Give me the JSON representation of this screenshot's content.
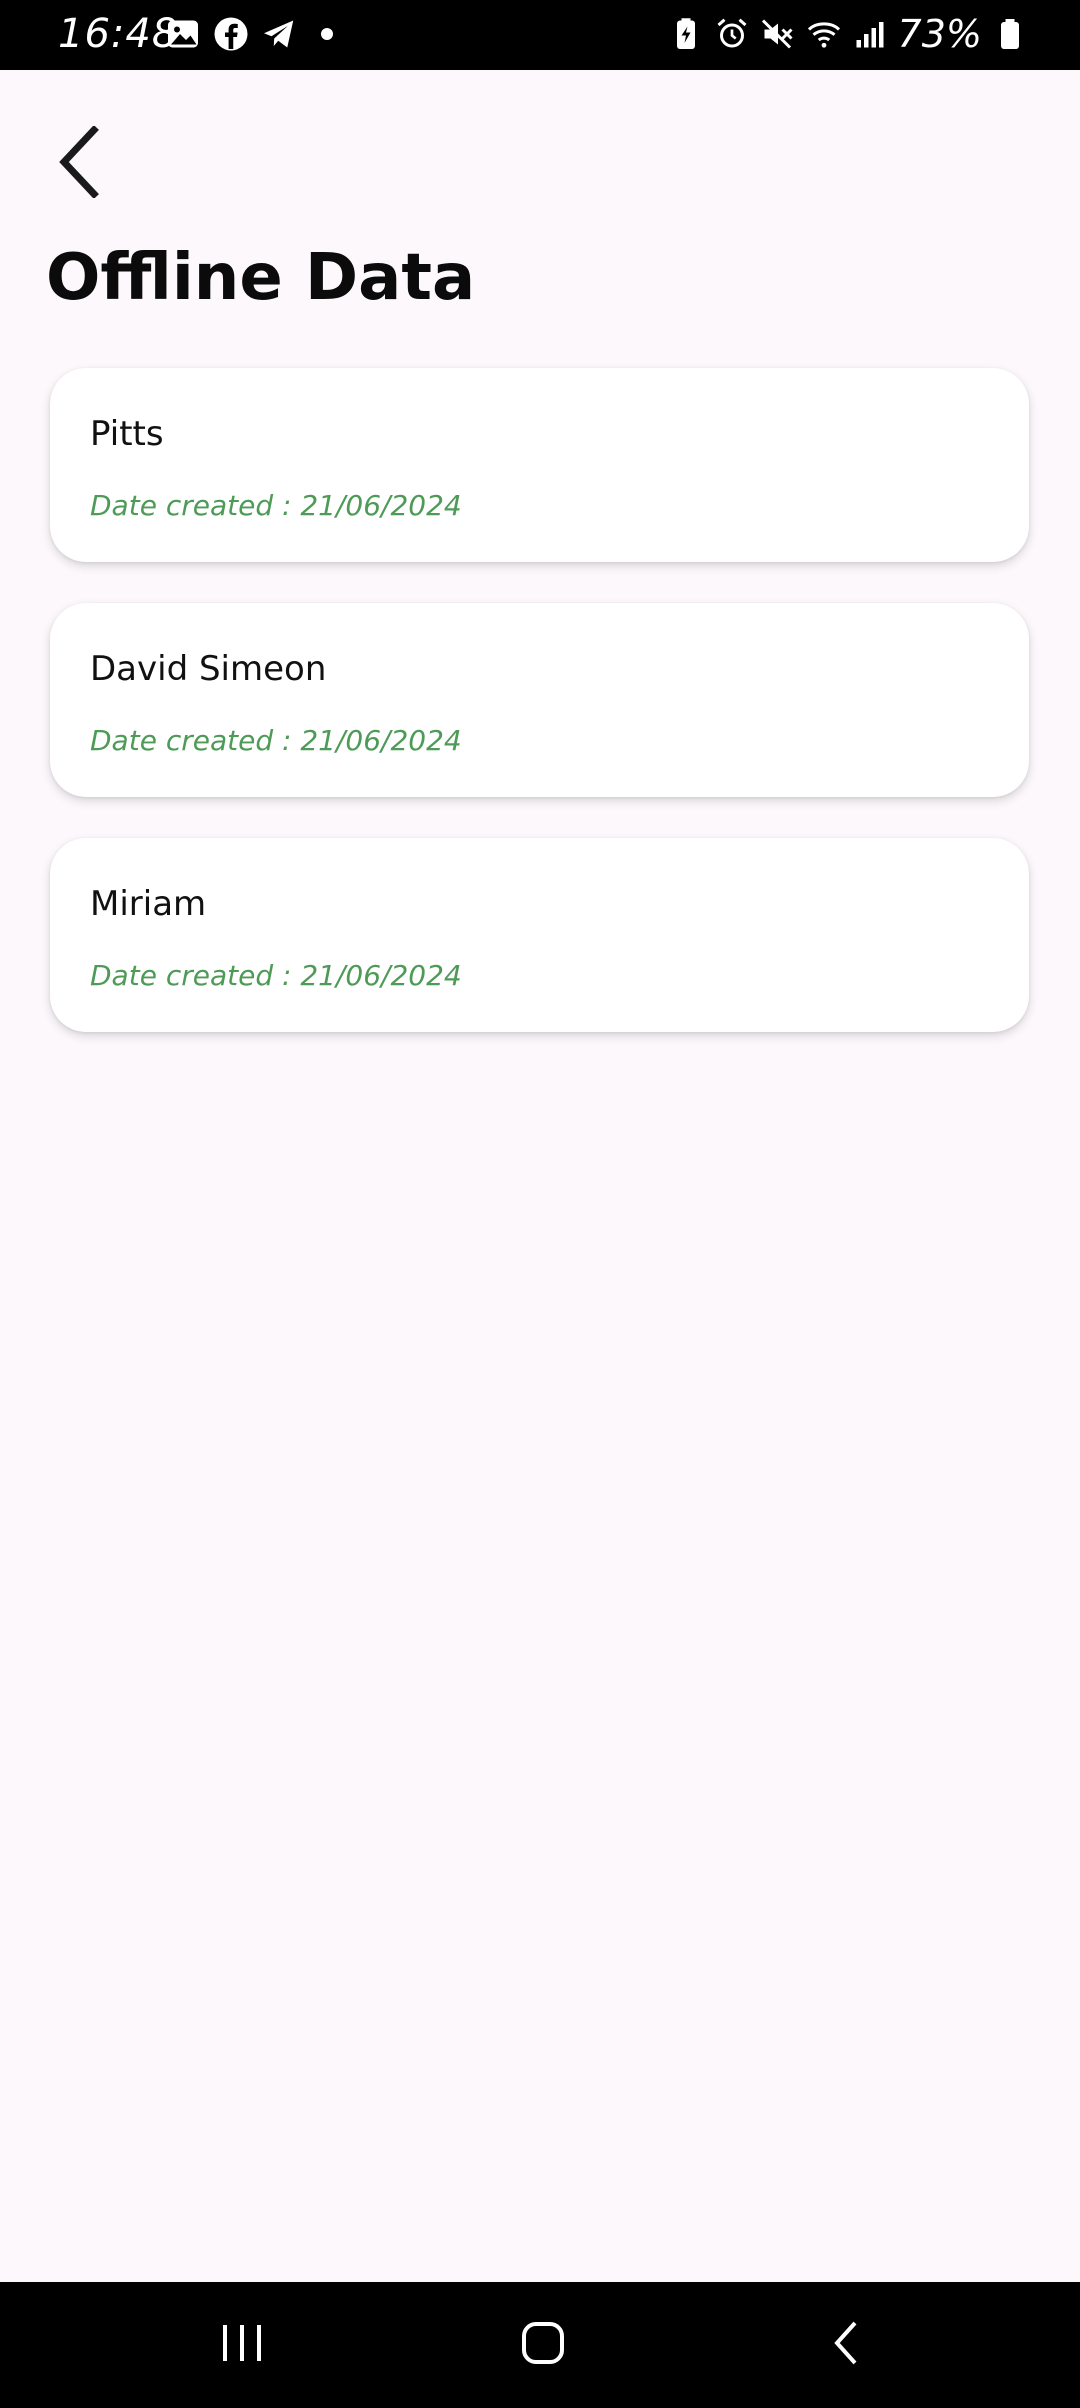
{
  "status_bar": {
    "time": "16:48",
    "battery": "73%",
    "left_icons": [
      "gallery-icon",
      "facebook-icon",
      "telegram-icon",
      "dot-icon"
    ],
    "right_icons": [
      "battery-saver-icon",
      "alarm-icon",
      "mute-icon",
      "wifi-icon",
      "signal-icon",
      "battery-icon"
    ]
  },
  "header": {
    "back_icon": "chevron-left-icon",
    "title": "Offline Data"
  },
  "records": [
    {
      "name": "Pitts",
      "date": "Date created : 21/06/2024"
    },
    {
      "name": "David Simeon",
      "date": "Date created : 21/06/2024"
    },
    {
      "name": "Miriam",
      "date": "Date created : 21/06/2024"
    }
  ],
  "navigation_bar": {
    "buttons": [
      "recents-icon",
      "home-icon",
      "back-icon"
    ]
  },
  "colors": {
    "background": "#fdf8fc",
    "card": "#ffffff",
    "date_text": "#4e9b57",
    "title_text": "#0b0b0b"
  }
}
